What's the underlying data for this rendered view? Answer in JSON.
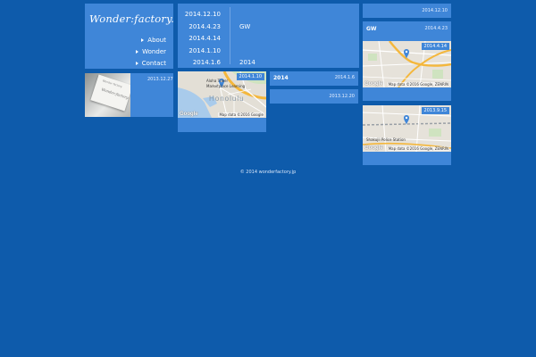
{
  "brand": {
    "logo_text": "Wonder:factory."
  },
  "nav": {
    "items": [
      {
        "label": "About"
      },
      {
        "label": "Wonder"
      },
      {
        "label": "Contact"
      }
    ]
  },
  "photo_post": {
    "date": "2013.12.27"
  },
  "archive": {
    "dates": [
      "2014.12.10",
      "2014.4.23",
      "2014.4.14",
      "2014.1.10",
      "2014.1.6"
    ],
    "labels": [
      "",
      "GW",
      "",
      "",
      "2014"
    ]
  },
  "map_post_honolulu": {
    "date": "2014.1.10",
    "map": {
      "city": "Honolulu",
      "places": [
        "Aloha Tower",
        "Marketplace Learning"
      ],
      "google_label": "Google",
      "attribution": "Map data ©2016 Google"
    }
  },
  "post_gw_2014": {
    "title": "2014",
    "date": "2014.1.6"
  },
  "post_20131220": {
    "date": "2013.12.20"
  },
  "post_20141210": {
    "date": "2014.12.10"
  },
  "post_gw": {
    "title": "GW",
    "date": "2014.4.23",
    "map": {
      "date": "2014.4.14",
      "google_label": "Google",
      "attribution": "Map data ©2016 Google, ZENRIN"
    }
  },
  "post_shakujii": {
    "map": {
      "date": "2013.9.15",
      "place": "Shakujii Police Station",
      "google_label": "Google",
      "attribution": "Map data ©2016 Google, ZENRIN"
    }
  },
  "footer": {
    "copyright": "© 2014 wonderfactory.jp"
  },
  "colors": {
    "background": "#0e5bab",
    "tile": "#3f86d8",
    "map_pin": "#3f86d8",
    "road": "#f4b73c"
  }
}
